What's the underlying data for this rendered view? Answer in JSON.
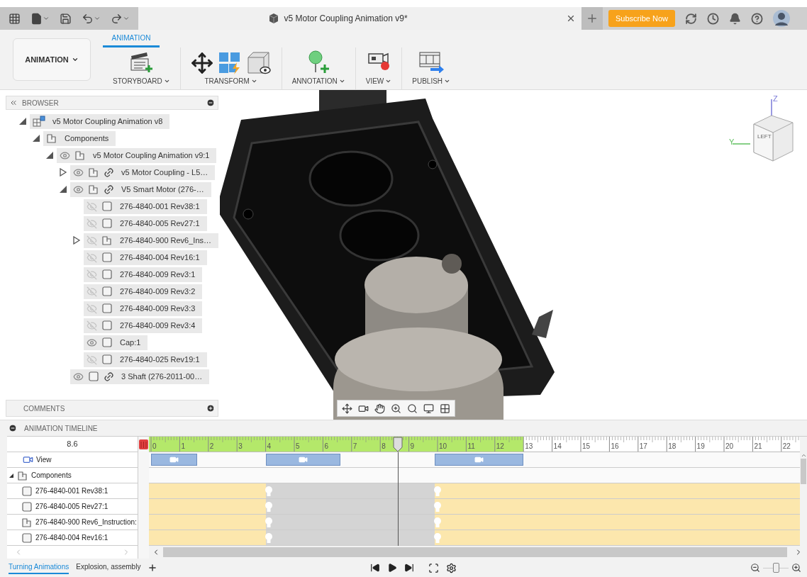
{
  "top_bar": {
    "document_title": "v5 Motor Coupling Animation v9*",
    "subscribe": "Subscribe Now"
  },
  "toolbar": {
    "workspace": "ANIMATION",
    "tabs": [
      {
        "label": "ANIMATION",
        "selected": true
      }
    ],
    "groups": [
      {
        "label": "STORYBOARD"
      },
      {
        "label": "TRANSFORM"
      },
      {
        "label": "ANNOTATION"
      },
      {
        "label": "VIEW"
      },
      {
        "label": "PUBLISH"
      }
    ]
  },
  "browser": {
    "title": "BROWSER",
    "tree": [
      {
        "kind": "design",
        "label": "v5 Motor Coupling Animation v8",
        "expanded": true,
        "children": [
          {
            "kind": "component",
            "label": "Components",
            "expanded": true,
            "children": [
              {
                "kind": "component",
                "label": "v5 Motor Coupling Animation v9:1",
                "expanded": true,
                "visible": true,
                "children": [
                  {
                    "kind": "component",
                    "label": "v5 Motor Coupling - L5…",
                    "expanded": false,
                    "visible": true,
                    "linked": true
                  },
                  {
                    "kind": "component",
                    "label": "V5 Smart Motor (276-…",
                    "expanded": true,
                    "visible": true,
                    "linked": true,
                    "children": [
                      {
                        "kind": "body",
                        "label": "276-4840-001 Rev38:1",
                        "visible": false
                      },
                      {
                        "kind": "body",
                        "label": "276-4840-005 Rev27:1",
                        "visible": false
                      },
                      {
                        "kind": "component",
                        "label": "276-4840-900 Rev6_Ins…",
                        "expanded": false,
                        "visible": false
                      },
                      {
                        "kind": "body",
                        "label": "276-4840-004 Rev16:1",
                        "visible": false
                      },
                      {
                        "kind": "body",
                        "label": "276-4840-009 Rev3:1",
                        "visible": false
                      },
                      {
                        "kind": "body",
                        "label": "276-4840-009 Rev3:2",
                        "visible": false
                      },
                      {
                        "kind": "body",
                        "label": "276-4840-009 Rev3:3",
                        "visible": false
                      },
                      {
                        "kind": "body",
                        "label": "276-4840-009 Rev3:4",
                        "visible": false
                      },
                      {
                        "kind": "body",
                        "label": "Cap:1",
                        "visible": true
                      },
                      {
                        "kind": "body",
                        "label": "276-4840-025 Rev19:1",
                        "visible": false
                      }
                    ]
                  },
                  {
                    "kind": "body",
                    "label": "3 Shaft (276-2011-00…",
                    "visible": true,
                    "linked": true
                  }
                ]
              }
            ]
          }
        ]
      }
    ]
  },
  "comments": {
    "title": "COMMENTS"
  },
  "view_cube": {
    "face": "LEFT",
    "axes": [
      "Z",
      "Y"
    ]
  },
  "timeline": {
    "title": "ANIMATION TIMELINE",
    "current_time": "8.6",
    "playhead": {
      "level": 0.391
    },
    "animated": {
      "level": 0.591
    },
    "ticks": [
      "0",
      "1",
      "2",
      "3",
      "4",
      "5",
      "6",
      "7",
      "8",
      "9",
      "10",
      "11",
      "12",
      "13",
      "14",
      "15",
      "16",
      "17",
      "18",
      "19",
      "20",
      "21",
      "22"
    ],
    "rows": [
      {
        "kind": "view",
        "label": "View"
      },
      {
        "kind": "group",
        "label": "Components",
        "expanded": true
      },
      {
        "kind": "body",
        "label": "276-4840-001 Rev38:1"
      },
      {
        "kind": "body",
        "label": "276-4840-005 Rev27:1"
      },
      {
        "kind": "component",
        "label": "276-4840-900 Rev6_Instruction:"
      },
      {
        "kind": "body",
        "label": "276-4840-004 Rev16:1"
      }
    ],
    "tabs": [
      {
        "label": "Turning Animations",
        "selected": true
      },
      {
        "label": "Explosion, assembly",
        "selected": false
      }
    ],
    "zoom": {
      "level": 0.5
    }
  }
}
